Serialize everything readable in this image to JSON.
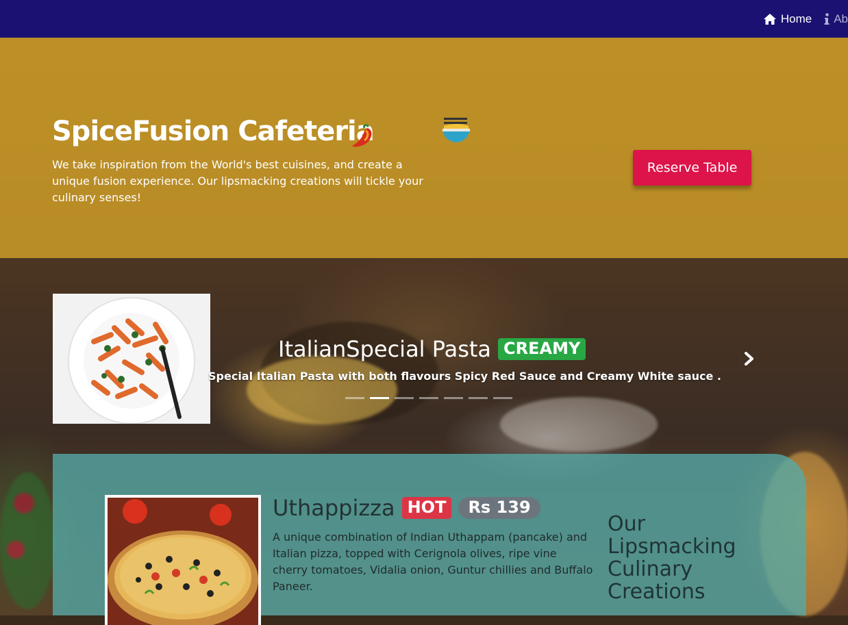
{
  "nav": {
    "items": [
      {
        "label": "Home",
        "icon": "home-icon"
      },
      {
        "label": "Ab",
        "icon": "info-icon"
      }
    ]
  },
  "hero": {
    "title": "SpiceFusion Cafeteria",
    "description": "We take inspiration from the World's best cuisines, and create a unique fusion experience. Our lipsmacking creations will tickle your culinary senses!",
    "reserve_label": "Reserve Table",
    "icons": [
      "chili-pepper-icon",
      "noodle-bowl-icon"
    ]
  },
  "carousel": {
    "slide_title": "ItalianSpecial Pasta",
    "slide_badge": "CREAMY",
    "slide_caption": "Special Italian Pasta with both flavours Spicy Red Sauce and Creamy White sauce .",
    "indicator_count": 7,
    "active_indicator": 1,
    "image": "pasta-dish-image"
  },
  "menu_item": {
    "name": "Uthappizza",
    "tag": "HOT",
    "price": "Rs 139",
    "description": "A unique combination of Indian Uthappam (pancake) and Italian pizza, topped with Cerignola olives, ripe vine cherry tomatoes, Vidalia onion, Guntur chillies and Buffalo Paneer.",
    "image": "pizza-image"
  },
  "section": {
    "heading": "Our Lipsmacking Culinary Creations"
  },
  "colors": {
    "navbar": "#1a1172",
    "hero_overlay": "#d6a428",
    "reserve_button": "#dc1449",
    "badge_creamy": "#29a745",
    "badge_hot": "#dc3545",
    "badge_price": "#6c757d",
    "menu_card": "#54aaa8"
  }
}
